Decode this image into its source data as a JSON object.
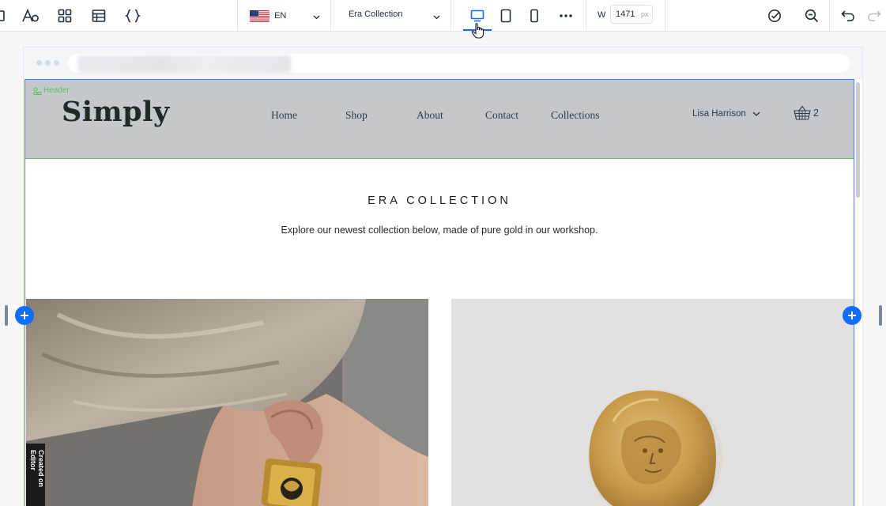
{
  "toolbar": {
    "language": "EN",
    "page_name": "Era Collection",
    "width_label": "W",
    "width_value": "1471",
    "width_unit": "px"
  },
  "site": {
    "header_tag": "Header",
    "logo": "Simply",
    "nav": [
      "Home",
      "Shop",
      "About",
      "Contact",
      "Collections"
    ],
    "user_name": "Lisa Harrison",
    "cart_count": "2",
    "section_title": "ERA COLLECTION",
    "section_subtitle": "Explore our newest collection below, made of pure gold in our workshop.",
    "badge": "Created on Editor"
  },
  "colors": {
    "accent": "#116dff",
    "header_bg": "#c3c8cd",
    "selection_green": "#5fbf5f"
  }
}
